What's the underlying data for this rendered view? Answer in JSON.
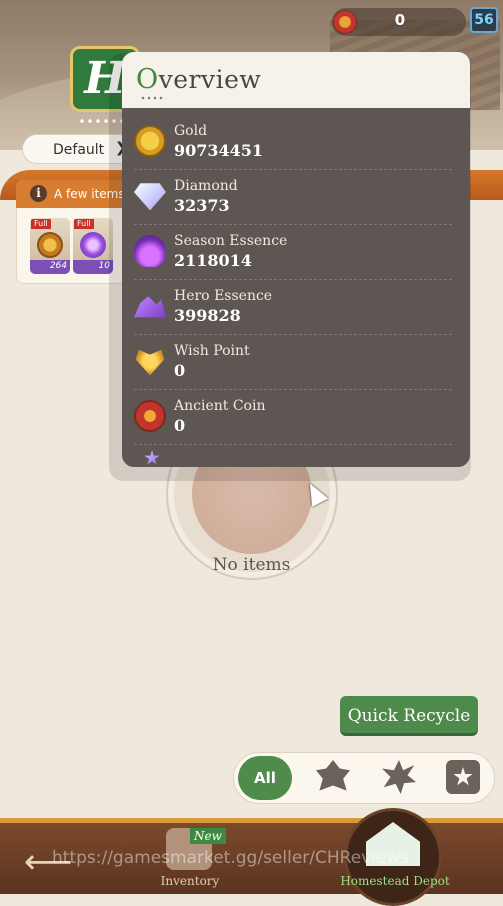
{
  "header": {
    "ancient_coin_count": "0",
    "level": "56",
    "logo_letter": "H",
    "sort_dropdown": {
      "selected": "Default"
    }
  },
  "notice": {
    "text": "A few items",
    "items": [
      {
        "badge": "Full",
        "count": "264",
        "icon": "gold-coin-icon"
      },
      {
        "badge": "Full",
        "count": "10",
        "icon": "purple-essence-icon"
      }
    ]
  },
  "overview": {
    "title_first_letter": "O",
    "title_rest": "verview",
    "resources": [
      {
        "name": "Gold",
        "value": "90734451",
        "icon": "gold-icon"
      },
      {
        "name": "Diamond",
        "value": "32373",
        "icon": "diamond-icon"
      },
      {
        "name": "Season Essence",
        "value": "2118014",
        "icon": "season-essence-icon"
      },
      {
        "name": "Hero Essence",
        "value": "399828",
        "icon": "hero-essence-icon"
      },
      {
        "name": "Wish Point",
        "value": "0",
        "icon": "wish-point-icon"
      },
      {
        "name": "Ancient Coin",
        "value": "0",
        "icon": "ancient-coin-icon"
      }
    ]
  },
  "main": {
    "empty_text": "No items"
  },
  "actions": {
    "quick_recycle": "Quick Recycle"
  },
  "filters": {
    "all_label": "All",
    "icons": [
      "leaf-filter-icon",
      "gear-filter-icon",
      "star-frame-filter-icon"
    ]
  },
  "bottom_nav": {
    "inventory_label": "Inventory",
    "inventory_badge": "New",
    "homestead_label": "Homestead Depot"
  },
  "watermark": "https://gamesmarket.gg/seller/CHReviews",
  "colors": {
    "accent_green": "#4e8a4b",
    "panel_bg": "#5d5652",
    "nav_bg": "#6b3d26"
  }
}
